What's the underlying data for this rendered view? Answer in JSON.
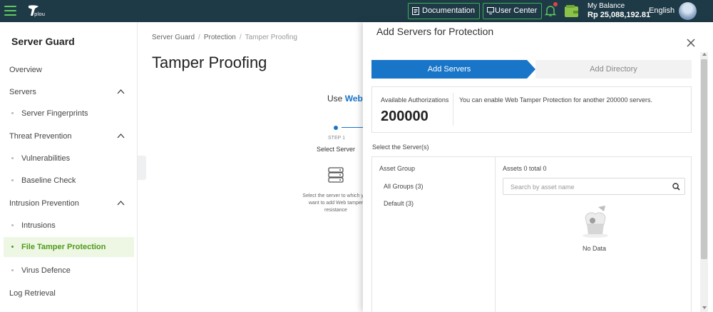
{
  "topbar": {
    "logo_text": "plou",
    "documentation_label": "Documentation",
    "user_center_label": "User Center",
    "balance_label": "My Balance",
    "balance_amount": "Rp 25,088,192.81",
    "language": "English",
    "accent_color": "#3fae56",
    "bg_color": "#1f3a47"
  },
  "sidebar": {
    "title": "Server Guard",
    "items": [
      {
        "label": "Overview"
      },
      {
        "label": "Servers"
      },
      {
        "label": "Server Fingerprints"
      },
      {
        "label": "Threat Prevention"
      },
      {
        "label": "Vulnerabilities"
      },
      {
        "label": "Baseline Check"
      },
      {
        "label": "Intrusion Prevention"
      },
      {
        "label": "Intrusions"
      },
      {
        "label": "File Tamper Protection"
      },
      {
        "label": "Virus Defence"
      },
      {
        "label": "Log Retrieval"
      }
    ],
    "active_item": "File Tamper Protection"
  },
  "main": {
    "breadcrumb": [
      "Server Guard",
      "Protection",
      "Tamper Proofing"
    ],
    "title": "Tamper Proofing",
    "use_text": "Use",
    "use_highlight": "Web",
    "step_number": "STEP 1",
    "step_name": "Select Server",
    "step_desc": "Select the server to which you want to add Web tamper resistance"
  },
  "modal": {
    "title": "Add Servers for Protection",
    "steps": [
      "Add Servers",
      "Add Directory"
    ],
    "auth_label": "Available Authorizations",
    "auth_value": "200000",
    "auth_message": "You can enable Web Tamper Protection for another 200000 servers.",
    "select_label": "Select the Server(s)",
    "asset_group_header": "Asset Group",
    "asset_groups": [
      "All Groups (3)",
      "Default (3)"
    ],
    "assets_header": "Assets 0 total 0",
    "search_placeholder": "Search by asset name",
    "no_data": "No Data"
  }
}
